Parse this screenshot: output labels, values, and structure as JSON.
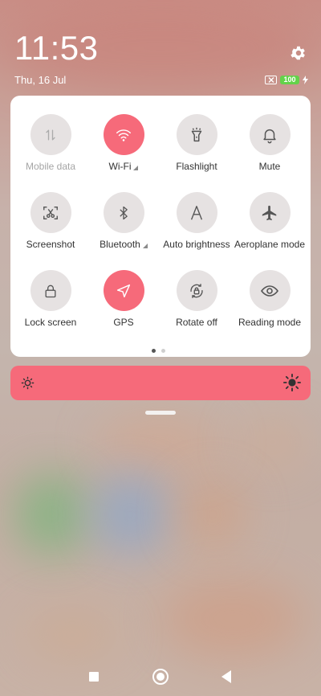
{
  "status": {
    "time": "11:53",
    "date": "Thu, 16 Jul",
    "battery_level": "100"
  },
  "quick_settings": {
    "tiles": [
      {
        "label": "Mobile data",
        "icon": "mobile-data-icon",
        "state": "disabled"
      },
      {
        "label": "Wi-Fi",
        "icon": "wifi-icon",
        "state": "on",
        "has_arrow": true
      },
      {
        "label": "Flashlight",
        "icon": "flashlight-icon",
        "state": "off"
      },
      {
        "label": "Mute",
        "icon": "bell-icon",
        "state": "off"
      },
      {
        "label": "Screenshot",
        "icon": "screenshot-icon",
        "state": "off"
      },
      {
        "label": "Bluetooth",
        "icon": "bluetooth-icon",
        "state": "off",
        "has_arrow": true
      },
      {
        "label": "Auto brightness",
        "icon": "auto-brightness-icon",
        "state": "off"
      },
      {
        "label": "Aeroplane mode",
        "icon": "airplane-icon",
        "state": "off"
      },
      {
        "label": "Lock screen",
        "icon": "lock-icon",
        "state": "off"
      },
      {
        "label": "GPS",
        "icon": "gps-icon",
        "state": "on"
      },
      {
        "label": "Rotate off",
        "icon": "rotate-lock-icon",
        "state": "off"
      },
      {
        "label": "Reading mode",
        "icon": "eye-icon",
        "state": "off"
      }
    ],
    "page_count": 2,
    "current_page": 1
  },
  "brightness": {
    "level": 1.0
  },
  "colors": {
    "accent": "#f66a7a",
    "tile_off": "#e6e2e2",
    "battery": "#63d24a"
  }
}
